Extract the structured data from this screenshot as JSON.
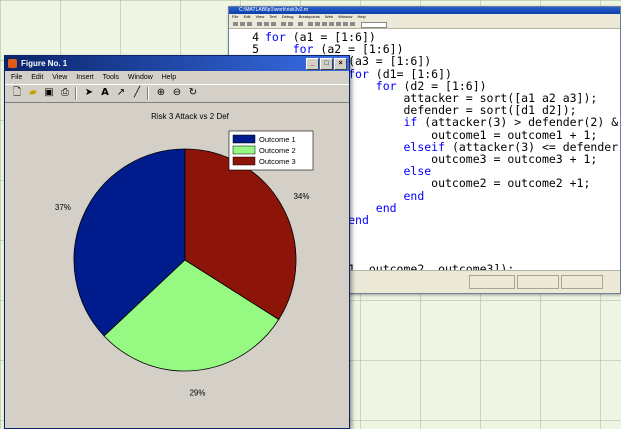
{
  "editor": {
    "title": "C:\\MATLAB6p1\\work\\risk3v2.m",
    "menu": [
      "File",
      "Edit",
      "View",
      "Text",
      "Debug",
      "Breakpoints",
      "Web",
      "Window",
      "Help"
    ],
    "code_lines": [
      {
        "num": "4",
        "text": "for (a1 = [1:6])"
      },
      {
        "num": "5",
        "text": "    for (a2 = [1:6])"
      },
      {
        "num": "",
        "text": "        for (a3 = [1:6])"
      },
      {
        "num": "",
        "text": "            for (d1= [1:6])"
      },
      {
        "num": "",
        "text": "                for (d2 = [1:6])"
      },
      {
        "num": "",
        "text": "                    attacker = sort([a1 a2 a3]);"
      },
      {
        "num": "",
        "text": "                    defender = sort([d1 d2]);"
      },
      {
        "num": "",
        "text": "                    if (attacker(3) > defender(2) &"
      },
      {
        "num": "",
        "text": "                        outcome1 = outcome1 + 1;"
      },
      {
        "num": "",
        "text": "                    elseif (attacker(3) <= defender"
      },
      {
        "num": "",
        "text": "                        outcome3 = outcome3 + 1;"
      },
      {
        "num": "",
        "text": "                    else"
      },
      {
        "num": "",
        "text": "                        outcome2 = outcome2 +1;"
      },
      {
        "num": "",
        "text": "                    end"
      },
      {
        "num": "",
        "text": "                end"
      },
      {
        "num": "",
        "text": "            end"
      },
      {
        "num": "",
        "text": ""
      },
      {
        "num": "",
        "text": ""
      },
      {
        "num": "",
        "text": ""
      },
      {
        "num": "",
        "text": "pie([outcome1, outcome2, outcome3]);"
      }
    ]
  },
  "figure": {
    "title": "Figure No. 1",
    "menu": [
      "File",
      "Edit",
      "View",
      "Insert",
      "Tools",
      "Window",
      "Help"
    ],
    "toolbar_icons": [
      "new-file-icon",
      "open-folder-icon",
      "save-icon",
      "print-icon",
      "arrow-icon",
      "text-icon",
      "arrow-line-icon",
      "line-icon",
      "zoom-in-icon",
      "zoom-out-icon",
      "rotate-icon"
    ],
    "window_controls": [
      "_",
      "□",
      "×"
    ]
  },
  "chart_data": {
    "type": "pie",
    "title": "Risk 3 Attack vs 2 Def",
    "categories": [
      "Outcome 1",
      "Outcome 2",
      "Outcome 3"
    ],
    "values": [
      37,
      29,
      34
    ],
    "labels": [
      "37%",
      "29%",
      "34%"
    ],
    "colors": [
      "#001c8c",
      "#96fa82",
      "#8c1408"
    ],
    "legend_position": "top-right"
  }
}
